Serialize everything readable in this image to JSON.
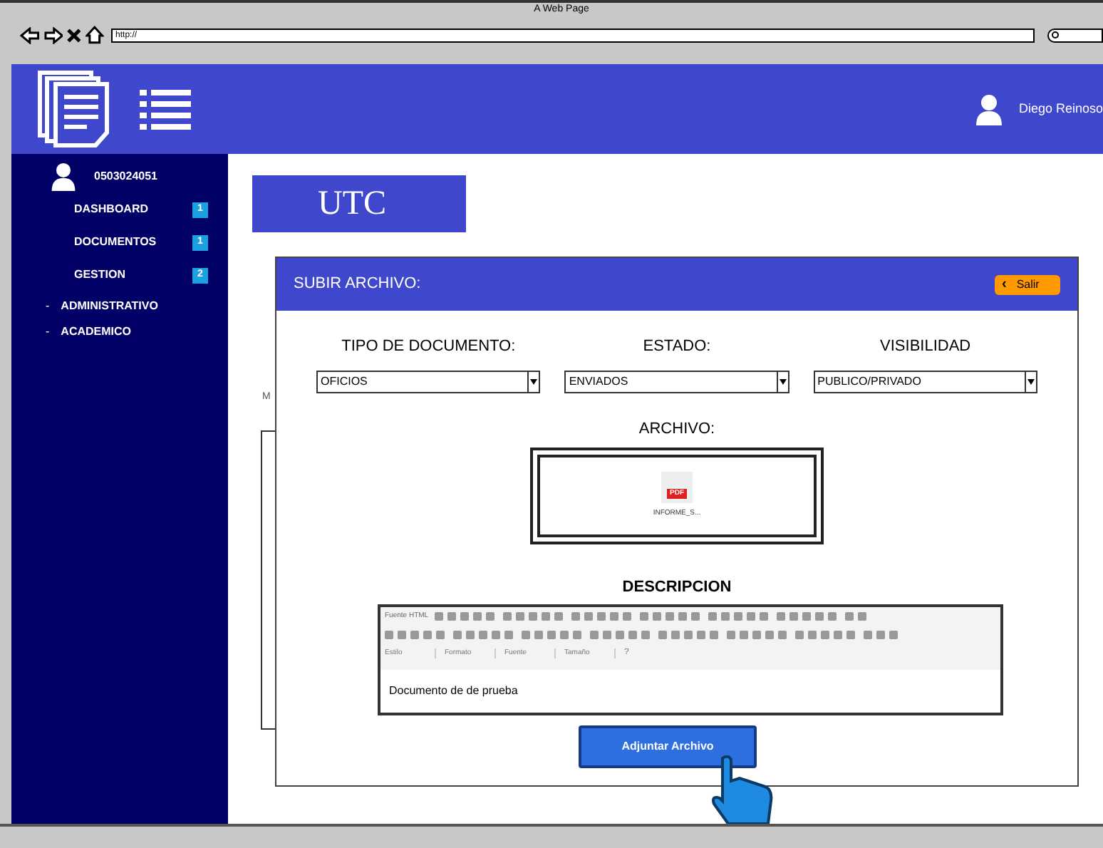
{
  "browser": {
    "title": "A Web Page",
    "url": "http://"
  },
  "header": {
    "user": "Diego Reinoso"
  },
  "sidebar": {
    "user_id": "0503024051",
    "items": [
      {
        "label": "DASHBOARD",
        "badge": "1"
      },
      {
        "label": "DOCUMENTOS",
        "badge": "1"
      },
      {
        "label": "GESTION",
        "badge": "2"
      }
    ],
    "submenu": [
      {
        "bullet": "-",
        "label": "ADMINISTRATIVO"
      },
      {
        "bullet": "-",
        "label": "ACADEMICO"
      }
    ]
  },
  "brand": "UTC",
  "background_label": "M",
  "modal": {
    "title": "SUBIR ARCHIVO:",
    "exit_button": {
      "icon": "‹",
      "label": "Salir"
    },
    "fields": [
      {
        "label": "TIPO DE DOCUMENTO:",
        "value": "OFICIOS"
      },
      {
        "label": "ESTADO:",
        "value": "ENVIADOS"
      },
      {
        "label": "VISIBILIDAD",
        "value": "PUBLICO/PRIVADO"
      }
    ],
    "file_label": "ARCHIVO:",
    "file": {
      "badge": "PDF",
      "name": "INFORME_S..."
    },
    "description_label": "DESCRIPCION",
    "editor": {
      "source_button": "Fuente HTML",
      "dropdowns": [
        "Estilo",
        "Formato",
        "Fuente",
        "Tamaño"
      ],
      "help": "?",
      "text": "Documento de de prueba"
    },
    "submit_button": "Adjuntar Archivo"
  }
}
